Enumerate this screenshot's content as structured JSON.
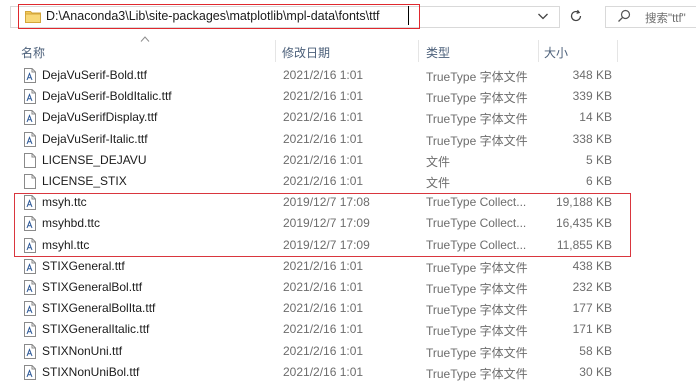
{
  "address": {
    "path": "D:\\Anaconda3\\Lib\\site-packages\\matplotlib\\mpl-data\\fonts\\ttf",
    "folder_icon": "folder-icon",
    "dropdown_icon": "chevron-down-icon",
    "refresh_icon": "refresh-icon"
  },
  "search": {
    "placeholder": "搜索\"ttf\"",
    "icon": "search-icon"
  },
  "columns": {
    "name": "名称",
    "date": "修改日期",
    "type": "类型",
    "size": "大小"
  },
  "files": [
    {
      "name": "DejaVuSerif-Bold.ttf",
      "date": "2021/2/16 1:01",
      "type": "TrueType 字体文件",
      "size": "348 KB",
      "icon": "font-file-icon"
    },
    {
      "name": "DejaVuSerif-BoldItalic.ttf",
      "date": "2021/2/16 1:01",
      "type": "TrueType 字体文件",
      "size": "339 KB",
      "icon": "font-file-icon"
    },
    {
      "name": "DejaVuSerifDisplay.ttf",
      "date": "2021/2/16 1:01",
      "type": "TrueType 字体文件",
      "size": "14 KB",
      "icon": "font-file-icon"
    },
    {
      "name": "DejaVuSerif-Italic.ttf",
      "date": "2021/2/16 1:01",
      "type": "TrueType 字体文件",
      "size": "338 KB",
      "icon": "font-file-icon"
    },
    {
      "name": "LICENSE_DEJAVU",
      "date": "2021/2/16 1:01",
      "type": "文件",
      "size": "5 KB",
      "icon": "generic-file-icon"
    },
    {
      "name": "LICENSE_STIX",
      "date": "2021/2/16 1:01",
      "type": "文件",
      "size": "6 KB",
      "icon": "generic-file-icon"
    },
    {
      "name": "msyh.ttc",
      "date": "2019/12/7 17:08",
      "type": "TrueType Collect...",
      "size": "19,188 KB",
      "icon": "font-file-icon"
    },
    {
      "name": "msyhbd.ttc",
      "date": "2019/12/7 17:09",
      "type": "TrueType Collect...",
      "size": "16,435 KB",
      "icon": "font-file-icon"
    },
    {
      "name": "msyhl.ttc",
      "date": "2019/12/7 17:09",
      "type": "TrueType Collect...",
      "size": "11,855 KB",
      "icon": "font-file-icon"
    },
    {
      "name": "STIXGeneral.ttf",
      "date": "2021/2/16 1:01",
      "type": "TrueType 字体文件",
      "size": "438 KB",
      "icon": "font-file-icon"
    },
    {
      "name": "STIXGeneralBol.ttf",
      "date": "2021/2/16 1:01",
      "type": "TrueType 字体文件",
      "size": "232 KB",
      "icon": "font-file-icon"
    },
    {
      "name": "STIXGeneralBolIta.ttf",
      "date": "2021/2/16 1:01",
      "type": "TrueType 字体文件",
      "size": "177 KB",
      "icon": "font-file-icon"
    },
    {
      "name": "STIXGeneralItalic.ttf",
      "date": "2021/2/16 1:01",
      "type": "TrueType 字体文件",
      "size": "171 KB",
      "icon": "font-file-icon"
    },
    {
      "name": "STIXNonUni.ttf",
      "date": "2021/2/16 1:01",
      "type": "TrueType 字体文件",
      "size": "58 KB",
      "icon": "font-file-icon"
    },
    {
      "name": "STIXNonUniBol.ttf",
      "date": "2021/2/16 1:01",
      "type": "TrueType 字体文件",
      "size": "30 KB",
      "icon": "font-file-icon"
    }
  ],
  "colors": {
    "highlight": "#e0282e",
    "header_text": "#4c607a",
    "folder": "#f3c95a"
  }
}
